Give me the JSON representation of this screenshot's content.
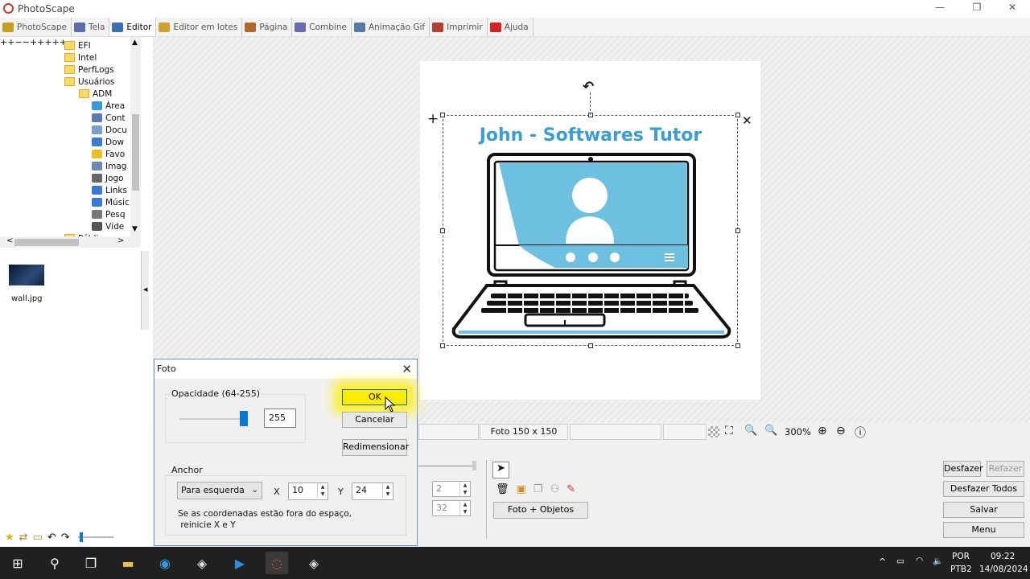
{
  "window": {
    "title": "PhotoScape",
    "controls": {
      "minimize": "—",
      "maximize": "❐",
      "close": "✕"
    }
  },
  "tabs": [
    {
      "label": "PhotoScape",
      "color": "#c8a020"
    },
    {
      "label": "Tela",
      "color": "#5a6ea8"
    },
    {
      "label": "Editor",
      "color": "#3b6fb0",
      "active": true
    },
    {
      "label": "Editor em lotes",
      "color": "#d0a030"
    },
    {
      "label": "Página",
      "color": "#b06a30"
    },
    {
      "label": "Combine",
      "color": "#6a6ab0"
    },
    {
      "label": "Animação Gif",
      "color": "#5a7aa0"
    },
    {
      "label": "Imprimir",
      "color": "#b04030"
    },
    {
      "label": "Ajuda",
      "color": "#d02020"
    }
  ],
  "tree": {
    "items": [
      "EFI",
      "Intel",
      "PerfLogs",
      "Usuários",
      "ADM",
      "Área",
      "Cont",
      "Docu",
      "Dow",
      "Favo",
      "Imag",
      "Jogo",
      "Links",
      "Músic",
      "Pesq",
      "Víde",
      "Público"
    ],
    "scroll": {
      "left": "<",
      "right": ">",
      "up": "^",
      "down": "v"
    }
  },
  "thumbnails": [
    {
      "name": "wall.jpg"
    }
  ],
  "bottom_icons": [
    "star-icon",
    "shuffle-icon",
    "folder-icon",
    "back-icon",
    "forward-icon"
  ],
  "canvas": {
    "logo_title": "John - Softwares Tutor",
    "rotate_glyph": "↶",
    "move_glyph": "+",
    "delete_glyph": "✕"
  },
  "status": {
    "photo_size": "Foto 150 x 150",
    "zoom": "300%"
  },
  "toolpanel": {
    "spin1": "2",
    "spin2": "32",
    "foto_objetos": "Foto + Objetos"
  },
  "actions": {
    "undo": "Desfazer",
    "redo": "Refazer",
    "undo_all": "Desfazer Todos",
    "save": "Salvar",
    "menu": "Menu"
  },
  "dialog": {
    "title": "Foto",
    "close": "✕",
    "opacity_label": "Opacidade (64-255)",
    "opacity_value": "255",
    "opacity_level": 1.0,
    "ok": "OK",
    "cancel": "Cancelar",
    "resize": "Redimensionar",
    "anchor_label": "Anchor",
    "anchor_value": "Para esquerda",
    "x_label": "X",
    "x_value": "10",
    "y_label": "Y",
    "y_value": "24",
    "hint": "Se as coordenadas estão fora do espaço,\n reinicie X e Y"
  },
  "taskbar": {
    "lang": "POR",
    "layout": "PTB2",
    "time": "09:22",
    "date": "14/08/2024"
  }
}
